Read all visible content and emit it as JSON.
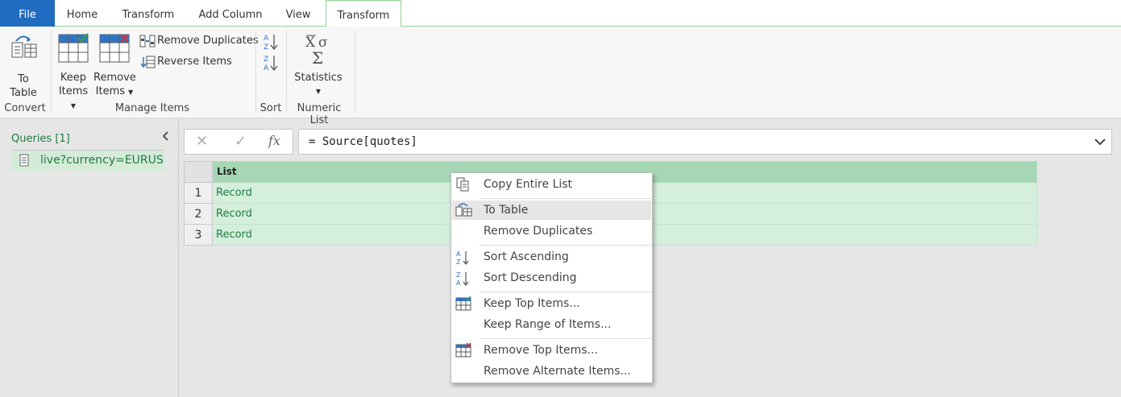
{
  "tabs": {
    "file": "File",
    "home": "Home",
    "transform": "Transform",
    "add_column": "Add Column",
    "view": "View",
    "list_tools_transform": "Transform"
  },
  "ribbon": {
    "to_table_line1": "To",
    "to_table_line2": "Table",
    "convert_group": "Convert",
    "keep_items_line1": "Keep",
    "keep_items_line2": "Items",
    "remove_items_line1": "Remove",
    "remove_items_line2": "Items",
    "remove_duplicates": "Remove Duplicates",
    "reverse_items": "Reverse Items",
    "manage_items_group": "Manage Items",
    "sort_group": "Sort",
    "statistics": "Statistics",
    "numeric_list_group": "Numeric List"
  },
  "queries": {
    "title": "Queries [1]",
    "items": [
      {
        "label": "live?currency=EURUS..."
      }
    ]
  },
  "formula_bar": {
    "cancel_glyph": "✕",
    "commit_glyph": "✓",
    "fx_glyph": "fx",
    "formula": "= Source[quotes]"
  },
  "grid": {
    "column_header": "List",
    "rows": [
      {
        "num": "1",
        "value": "Record"
      },
      {
        "num": "2",
        "value": "Record"
      },
      {
        "num": "3",
        "value": "Record"
      }
    ]
  },
  "context_menu": {
    "items": [
      {
        "label": "Copy Entire List",
        "icon": "copy-icon"
      },
      {
        "label": "To Table",
        "icon": "to-table-icon"
      },
      {
        "label": "Remove Duplicates",
        "icon": ""
      },
      {
        "label": "Sort Ascending",
        "icon": "sort-ascending-icon"
      },
      {
        "label": "Sort Descending",
        "icon": "sort-descending-icon"
      },
      {
        "label": "Keep Top Items...",
        "icon": "keep-top-icon"
      },
      {
        "label": "Keep Range of Items...",
        "icon": ""
      },
      {
        "label": "Remove Top Items...",
        "icon": "remove-top-icon"
      },
      {
        "label": "Remove Alternate Items...",
        "icon": ""
      }
    ]
  },
  "colors": {
    "accent_green": "#1e7b3f",
    "file_tab": "#1f6cc1",
    "column_header_bg": "#a5d7b4",
    "cell_bg": "#d5efdd"
  }
}
